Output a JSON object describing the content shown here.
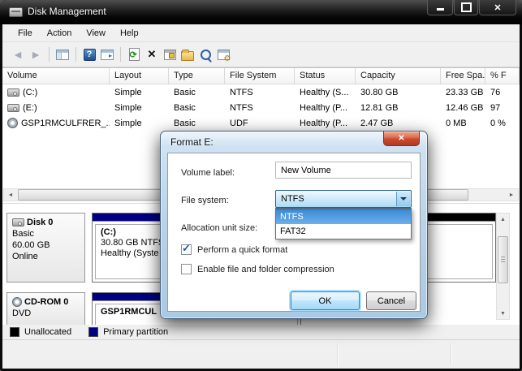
{
  "window": {
    "title": "Disk Management",
    "controls": [
      "minimize-icon",
      "maximize-icon",
      "close-icon"
    ]
  },
  "menu": {
    "items": [
      {
        "label": "File"
      },
      {
        "label": "Action"
      },
      {
        "label": "View"
      },
      {
        "label": "Help"
      }
    ]
  },
  "toolbar": {
    "icons": [
      "back-icon",
      "forward-icon",
      "show-console-tree-icon",
      "help-icon",
      "show-action-pane-icon",
      "refresh-icon",
      "delete-icon",
      "properties-icon",
      "open-icon",
      "find-icon",
      "options-icon"
    ]
  },
  "volume_list": {
    "columns": [
      {
        "label": "Volume"
      },
      {
        "label": "Layout"
      },
      {
        "label": "Type"
      },
      {
        "label": "File System"
      },
      {
        "label": "Status"
      },
      {
        "label": "Capacity"
      },
      {
        "label": "Free Spa..."
      },
      {
        "label": "% F"
      }
    ],
    "rows": [
      {
        "icon": "drive-icon",
        "volume": "(C:)",
        "layout": "Simple",
        "type": "Basic",
        "file_system": "NTFS",
        "status": "Healthy (S...",
        "capacity": "30.80 GB",
        "free_space": "23.33 GB",
        "percent_free": "76"
      },
      {
        "icon": "drive-icon",
        "volume": "(E:)",
        "layout": "Simple",
        "type": "Basic",
        "file_system": "NTFS",
        "status": "Healthy (P...",
        "capacity": "12.81 GB",
        "free_space": "12.46 GB",
        "percent_free": "97"
      },
      {
        "icon": "disc-icon",
        "volume": "GSP1RMCULFRER_...",
        "layout": "Simple",
        "type": "Basic",
        "file_system": "UDF",
        "status": "Healthy (P...",
        "capacity": "2.47 GB",
        "free_space": "0 MB",
        "percent_free": "0 %"
      }
    ]
  },
  "graphical_view": {
    "disk0": {
      "name": "Disk 0",
      "type": "Basic",
      "size": "60.00 GB",
      "status": "Online",
      "partition_c": {
        "label": "(C:)",
        "size_fs": "30.80 GB NTFS",
        "status": "Healthy (Syste"
      }
    },
    "cdrom0": {
      "name": "CD-ROM 0",
      "type": "DVD",
      "partition": {
        "label": "GSP1RMCUL"
      }
    }
  },
  "legend": {
    "items": [
      {
        "label": "Unallocated",
        "color": "#000000"
      },
      {
        "label": "Primary partition",
        "color": "#000082"
      }
    ]
  },
  "dialog": {
    "title": "Format E:",
    "volume_label": {
      "label": "Volume label:",
      "value": "New Volume"
    },
    "file_system": {
      "label": "File system:",
      "value": "NTFS",
      "options": [
        {
          "label": "NTFS",
          "selected": true
        },
        {
          "label": "FAT32",
          "selected": false
        }
      ]
    },
    "allocation_unit": {
      "label": "Allocation unit size:"
    },
    "checkboxes": [
      {
        "label": "Perform a quick format",
        "checked": true
      },
      {
        "label": "Enable file and folder compression",
        "checked": false
      }
    ],
    "buttons": {
      "ok": "OK",
      "cancel": "Cancel"
    }
  },
  "colors": {
    "primary_partition": "#000082",
    "unallocated": "#000000"
  }
}
